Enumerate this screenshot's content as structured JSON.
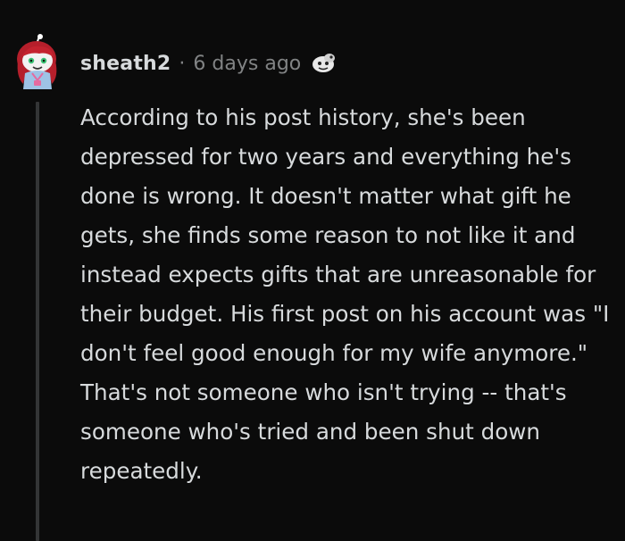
{
  "comment": {
    "username": "sheath2",
    "separator": "·",
    "timestamp": "6 days ago",
    "avatar_icon": "snoo-avatar-icon",
    "award_icon": "award-icon",
    "body": "According to his post history, she's been depressed for two years and everything he's done is wrong. It doesn't matter what gift he gets, she finds some reason to not like it and instead expects gifts that are unreasonable for their budget. His first post on his account was \"I don't feel good enough for my wife anymore.\" That's not someone who isn't trying -- that's someone who's tried and been shut down repeatedly."
  },
  "colors": {
    "background": "#0b0b0b",
    "text": "#d7dadc",
    "meta": "#818384",
    "thread_line": "#343536"
  }
}
